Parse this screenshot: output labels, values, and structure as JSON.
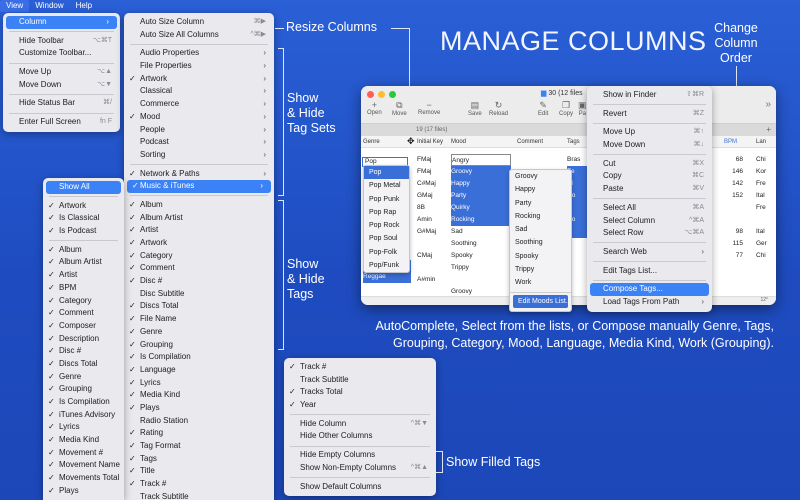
{
  "menubar": {
    "items": [
      "View",
      "Window",
      "Help"
    ],
    "active": "View"
  },
  "title": "MANAGE COLUMNS",
  "callouts": {
    "resize": "Resize Columns",
    "tag_sets": [
      "Show",
      "& Hide",
      "Tag Sets"
    ],
    "tags": [
      "Show",
      "& Hide",
      "Tags"
    ],
    "change_order": [
      "Change",
      "Column",
      "Order"
    ],
    "filled": "Show Filled Tags",
    "autocomplete": "AutoComplete, Select from the lists, or Compose manually Genre, Tags, Grouping, Category, Mood, Language, Media Kind, Work (Grouping)."
  },
  "view_menu": [
    {
      "label": "Column",
      "arrow": true,
      "hl": true
    },
    {
      "sep": true
    },
    {
      "label": "Hide Toolbar",
      "sc": "⌥⌘T"
    },
    {
      "label": "Customize Toolbar..."
    },
    {
      "sep": true
    },
    {
      "label": "Move Up",
      "sc": "⌥▲"
    },
    {
      "label": "Move Down",
      "sc": "⌥▼"
    },
    {
      "sep": true
    },
    {
      "label": "Hide Status Bar",
      "sc": "⌘/"
    },
    {
      "sep": true
    },
    {
      "label": "Enter Full Screen",
      "sc": "fn F"
    }
  ],
  "column_menu": [
    {
      "label": "Auto Size Column",
      "sc": "⌘▶"
    },
    {
      "label": "Auto Size All Columns",
      "sc": "^⌘▶"
    },
    {
      "sep": true
    },
    {
      "label": "Audio Properties",
      "arrow": true
    },
    {
      "label": "File Properties",
      "arrow": true
    },
    {
      "label": "Artwork",
      "check": true,
      "arrow": true
    },
    {
      "label": "Classical",
      "arrow": true
    },
    {
      "label": "Commerce",
      "arrow": true
    },
    {
      "label": "Mood",
      "check": true,
      "arrow": true
    },
    {
      "label": "People",
      "arrow": true
    },
    {
      "label": "Podcast",
      "arrow": true
    },
    {
      "label": "Sorting",
      "arrow": true
    },
    {
      "sep": true
    },
    {
      "label": "Network & Paths",
      "check": true,
      "arrow": true
    },
    {
      "label": "Music & iTunes",
      "check": true,
      "arrow": true,
      "hl": true
    },
    {
      "sep": true
    },
    {
      "label": "Album",
      "check": true
    },
    {
      "label": "Album Artist",
      "check": true
    },
    {
      "label": "Artist",
      "check": true
    },
    {
      "label": "Artwork",
      "check": true
    },
    {
      "label": "Category",
      "check": true
    },
    {
      "label": "Comment",
      "check": true
    },
    {
      "label": "Disc #",
      "check": true
    },
    {
      "label": "Disc Subtitle"
    },
    {
      "label": "Discs Total",
      "check": true
    },
    {
      "label": "File Name",
      "check": true
    },
    {
      "label": "Genre",
      "check": true
    },
    {
      "label": "Grouping",
      "check": true
    },
    {
      "label": "Is Compilation",
      "check": true
    },
    {
      "label": "Language",
      "check": true
    },
    {
      "label": "Lyrics",
      "check": true
    },
    {
      "label": "Media Kind",
      "check": true
    },
    {
      "label": "Plays",
      "check": true
    },
    {
      "label": "Radio Station"
    },
    {
      "label": "Rating",
      "check": true
    },
    {
      "label": "Tag Format",
      "check": true
    },
    {
      "label": "Tags",
      "check": true
    },
    {
      "label": "Title",
      "check": true
    },
    {
      "label": "Track #",
      "check": true
    },
    {
      "label": "Track Subtitle"
    }
  ],
  "tagset_menu": [
    {
      "label": "Show All",
      "hl": true
    },
    {
      "sep": true
    },
    {
      "label": "Artwork",
      "check": true
    },
    {
      "label": "Is Classical",
      "check": true
    },
    {
      "label": "Is Podcast",
      "check": true
    },
    {
      "sep": true
    },
    {
      "label": "Album",
      "check": true
    },
    {
      "label": "Album Artist",
      "check": true
    },
    {
      "label": "Artist",
      "check": true
    },
    {
      "label": "BPM",
      "check": true
    },
    {
      "label": "Category",
      "check": true
    },
    {
      "label": "Comment",
      "check": true
    },
    {
      "label": "Composer",
      "check": true
    },
    {
      "label": "Description",
      "check": true
    },
    {
      "label": "Disc #",
      "check": true
    },
    {
      "label": "Discs Total",
      "check": true
    },
    {
      "label": "Genre",
      "check": true
    },
    {
      "label": "Grouping",
      "check": true
    },
    {
      "label": "Is Compilation",
      "check": true
    },
    {
      "label": "iTunes Advisory",
      "check": true
    },
    {
      "label": "Lyrics",
      "check": true
    },
    {
      "label": "Media Kind",
      "check": true
    },
    {
      "label": "Movement #",
      "check": true
    },
    {
      "label": "Movement Name",
      "check": true
    },
    {
      "label": "Movements Total",
      "check": true
    },
    {
      "label": "Plays",
      "check": true
    }
  ],
  "filled_menu": [
    {
      "label": "Track #",
      "check": true
    },
    {
      "label": "Track Subtitle"
    },
    {
      "label": "Tracks Total",
      "check": true
    },
    {
      "label": "Year",
      "check": true
    },
    {
      "sep": true
    },
    {
      "label": "Hide Column",
      "sc": "^⌘▼"
    },
    {
      "label": "Hide Other Columns"
    },
    {
      "sep": true
    },
    {
      "label": "Hide Empty Columns"
    },
    {
      "label": "Show Non-Empty Columns",
      "sc": "^⌘▲"
    },
    {
      "sep": true
    },
    {
      "label": "Show Default Columns"
    }
  ],
  "context_menu": [
    {
      "label": "Show in Finder",
      "sc": "⇧⌘R"
    },
    {
      "sep": true
    },
    {
      "label": "Revert",
      "sc": "⌘Z"
    },
    {
      "sep": true
    },
    {
      "label": "Move Up",
      "sc": "⌘↑"
    },
    {
      "label": "Move Down",
      "sc": "⌘↓"
    },
    {
      "sep": true
    },
    {
      "label": "Cut",
      "sc": "⌘X"
    },
    {
      "label": "Copy",
      "sc": "⌘C"
    },
    {
      "label": "Paste",
      "sc": "⌘V"
    },
    {
      "sep": true
    },
    {
      "label": "Select All",
      "sc": "⌘A"
    },
    {
      "label": "Select Column",
      "sc": "^⌘A"
    },
    {
      "label": "Select Row",
      "sc": "⌥⌘A"
    },
    {
      "sep": true
    },
    {
      "label": "Search Web",
      "arrow": true
    },
    {
      "sep": true
    },
    {
      "label": "Edit Tags List..."
    },
    {
      "sep": true
    },
    {
      "label": "Compose Tags...",
      "hl": true
    },
    {
      "label": "Load Tags From Path",
      "arrow": true
    }
  ],
  "window": {
    "title": "30 (12 files",
    "toolbar": [
      "Open",
      "Move",
      "Remove",
      "Save",
      "Reload",
      "Edit",
      "Copy",
      "Pa"
    ],
    "subheader": "19 (17 files)",
    "col_headers": [
      "Genre",
      "Initial Key",
      "Mood",
      "Comment",
      "Tags",
      "BPM",
      "Lan"
    ],
    "genre_input": "Pop",
    "genre_list": [
      "Pop",
      "Pop Metal",
      "Pop Punk",
      "Pop Rap",
      "Pop Rock",
      "Pop Soul",
      "Pop-Folk",
      "Pop/Funk"
    ],
    "genre_tail": [
      "Latin",
      "Reggae"
    ],
    "keys": [
      "FMaj",
      "FMaj",
      "C#Maj",
      "GMaj",
      "8B",
      "Amin",
      "G#Maj",
      "",
      "CMaj",
      "",
      "A#min"
    ],
    "moods": [
      "Angry",
      "Groovy",
      "Happy",
      "Party",
      "Quirky",
      "Rocking",
      "Sad",
      "Soothing",
      "Spooky",
      "Trippy",
      "",
      "Groovy"
    ],
    "mood_list": [
      "Groovy",
      "Happy",
      "Party",
      "Rocking",
      "Sad",
      "Soothing",
      "Spooky",
      "Trippy",
      "Work"
    ],
    "mood_list_button": "Edit Moods List...",
    "tags_col": [
      "Bras",
      "Fe",
      "Al",
      "Ro",
      "Li",
      "Ro",
      "M",
      "",
      "",
      "",
      "",
      ""
    ],
    "bpm": [
      "68",
      "146",
      "142",
      "152",
      "",
      "",
      "98",
      "115",
      "77",
      "",
      "",
      ""
    ],
    "lang": [
      "Chi",
      "Kor",
      "Fre",
      "Ital",
      "Fre",
      "",
      "Ital",
      "Ger",
      "Chi",
      "",
      "",
      ""
    ],
    "status": "12°"
  }
}
